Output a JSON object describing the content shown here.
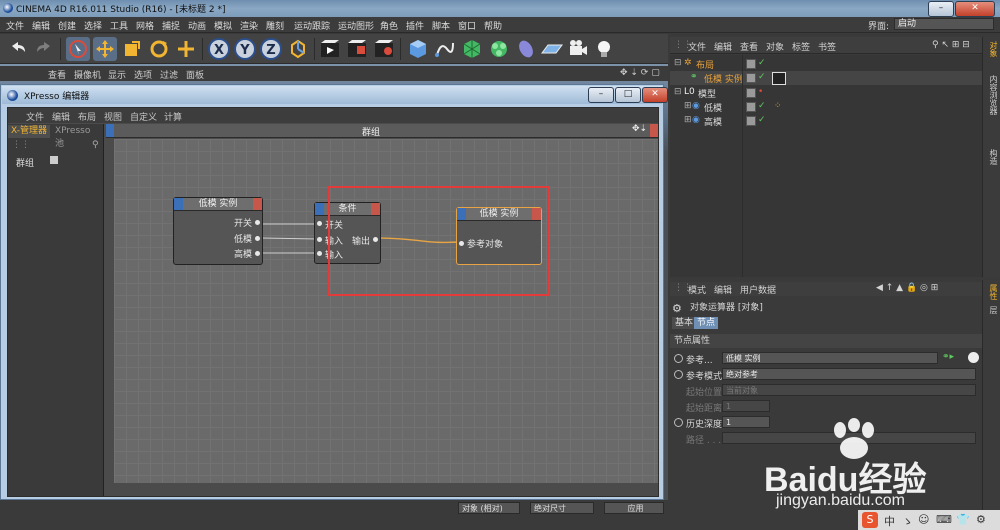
{
  "window": {
    "title": "CINEMA 4D R16.011 Studio (R16) - [未标题 2 *]",
    "btn_min": "–",
    "btn_max": "□",
    "btn_close": "✕"
  },
  "menubar": {
    "items": [
      "文件",
      "编辑",
      "创建",
      "选择",
      "工具",
      "网格",
      "捕捉",
      "动画",
      "模拟",
      "渲染",
      "雕刻",
      "运动跟踪",
      "运动图形",
      "角色",
      "插件",
      "脚本",
      "窗口",
      "帮助"
    ],
    "layout_label": "界面:",
    "layout_value": "启动"
  },
  "toolbar": {
    "icons": [
      "undo-icon",
      "redo-icon",
      "live-select-icon",
      "move-icon",
      "scale-icon",
      "rotate-icon",
      "coordinate-icon",
      "x-axis-icon",
      "y-axis-icon",
      "z-axis-icon",
      "world-coord-icon",
      "render-view-icon",
      "render-picture-queue-icon",
      "render-settings-icon",
      "cube-icon",
      "spline-pen-icon",
      "subdivision-icon",
      "cloner-icon",
      "deformer-icon",
      "floor-icon",
      "camera-icon",
      "light-icon"
    ],
    "axis_x": "X",
    "axis_y": "Y",
    "axis_z": "Z"
  },
  "viewport": {
    "menu": [
      "查看",
      "摄像机",
      "显示",
      "选项",
      "过滤",
      "面板"
    ]
  },
  "xpresso": {
    "title": "XPresso 编辑器",
    "menu": [
      "文件",
      "编辑",
      "布局",
      "视图",
      "自定义",
      "计算"
    ],
    "tabs": [
      "X-管理器",
      "XPresso 池"
    ],
    "tree_item": "群组",
    "graph_title": "群组",
    "nodes": {
      "n1": {
        "title": "低模 实例",
        "ports": [
          "开关",
          "低模",
          "高模"
        ]
      },
      "n2": {
        "title": "条件",
        "inputs": [
          "开关",
          "输入",
          "输入"
        ],
        "output": "输出"
      },
      "n3": {
        "title": "低模 实例",
        "inputs": [
          "参考对象"
        ]
      }
    }
  },
  "objects": {
    "menu": [
      "文件",
      "编辑",
      "查看",
      "对象",
      "标签",
      "书签"
    ],
    "rows": [
      {
        "name": "布局",
        "color": "#e9a23b"
      },
      {
        "name": "低模 实例",
        "color": "#e9a23b"
      },
      {
        "name": "模型",
        "color": "#dcdcdc"
      },
      {
        "name": "低模",
        "color": "#dcdcdc"
      },
      {
        "name": "高模",
        "color": "#dcdcdc"
      }
    ],
    "side_tabs": [
      "对象",
      "内容浏览器",
      "构造"
    ]
  },
  "attributes": {
    "menu": [
      "模式",
      "编辑",
      "用户数据"
    ],
    "object_label": "对象运算器 [对象]",
    "tabs": [
      "基本",
      "节点"
    ],
    "section": "节点属性",
    "fields": [
      {
        "label": "参考...",
        "value": "低模 实例"
      },
      {
        "label": "参考模式",
        "value": "绝对参考"
      },
      {
        "label": "起始位置",
        "value": "当前对象"
      },
      {
        "label": "起始距离",
        "value": "1"
      },
      {
        "label": "历史深度",
        "value": "1"
      },
      {
        "label": "路径 . . .",
        "value": ""
      }
    ],
    "side_tabs": [
      "属性",
      "层"
    ]
  },
  "bottom": {
    "coord_mode": "对象 (相对)",
    "size_mode": "绝对尺寸",
    "apply": "应用"
  },
  "watermark": {
    "brand": "Baidu经验",
    "url": "jingyan.baidu.com"
  },
  "taskbar": {
    "ime": "中",
    "items": [
      "S",
      "中",
      "ゝ",
      "☺",
      "⌨",
      "👕",
      "⚙"
    ]
  }
}
